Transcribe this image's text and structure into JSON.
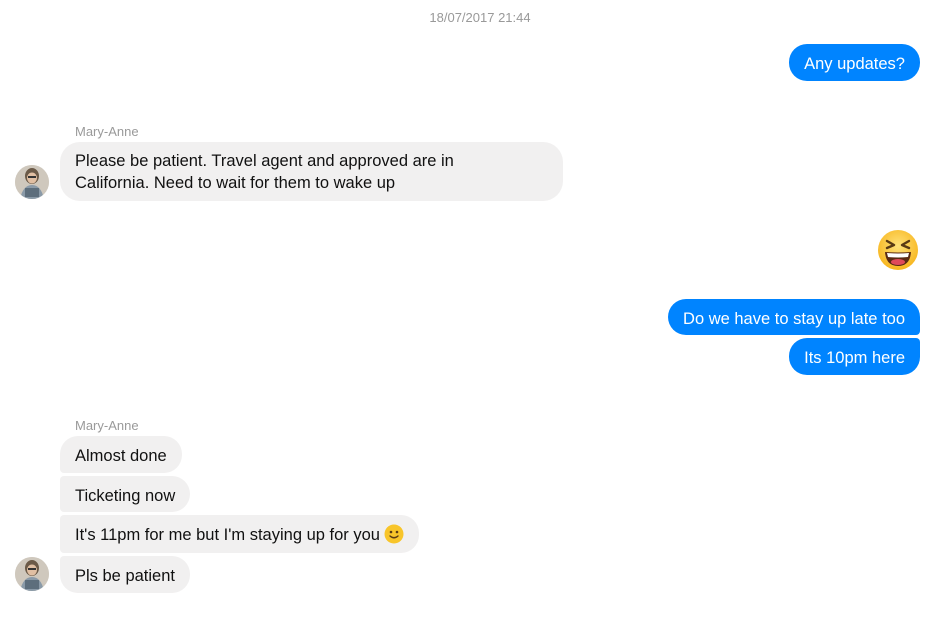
{
  "timestamp": "18/07/2017 21:44",
  "contact_name": "Mary-Anne",
  "messages": {
    "m1": "Any updates?",
    "m2": "Please be patient. Travel agent and approved are in",
    "m2b": "California. Need to wait for them to wake up",
    "m4": "Do we have to stay up late too",
    "m5": "Its 10pm here",
    "m6": "Almost done",
    "m7": "Ticketing now",
    "m8": "It's 11pm for me but I'm staying up for you",
    "m9": "Pls be patient"
  },
  "icons": {
    "reaction": "grinning-squinting-face-icon",
    "smile": "slightly-smiling-face-icon",
    "avatar": "contact-avatar"
  },
  "colors": {
    "outgoing": "#0084ff",
    "incoming": "#f1f0f0",
    "meta_text": "#999999"
  }
}
